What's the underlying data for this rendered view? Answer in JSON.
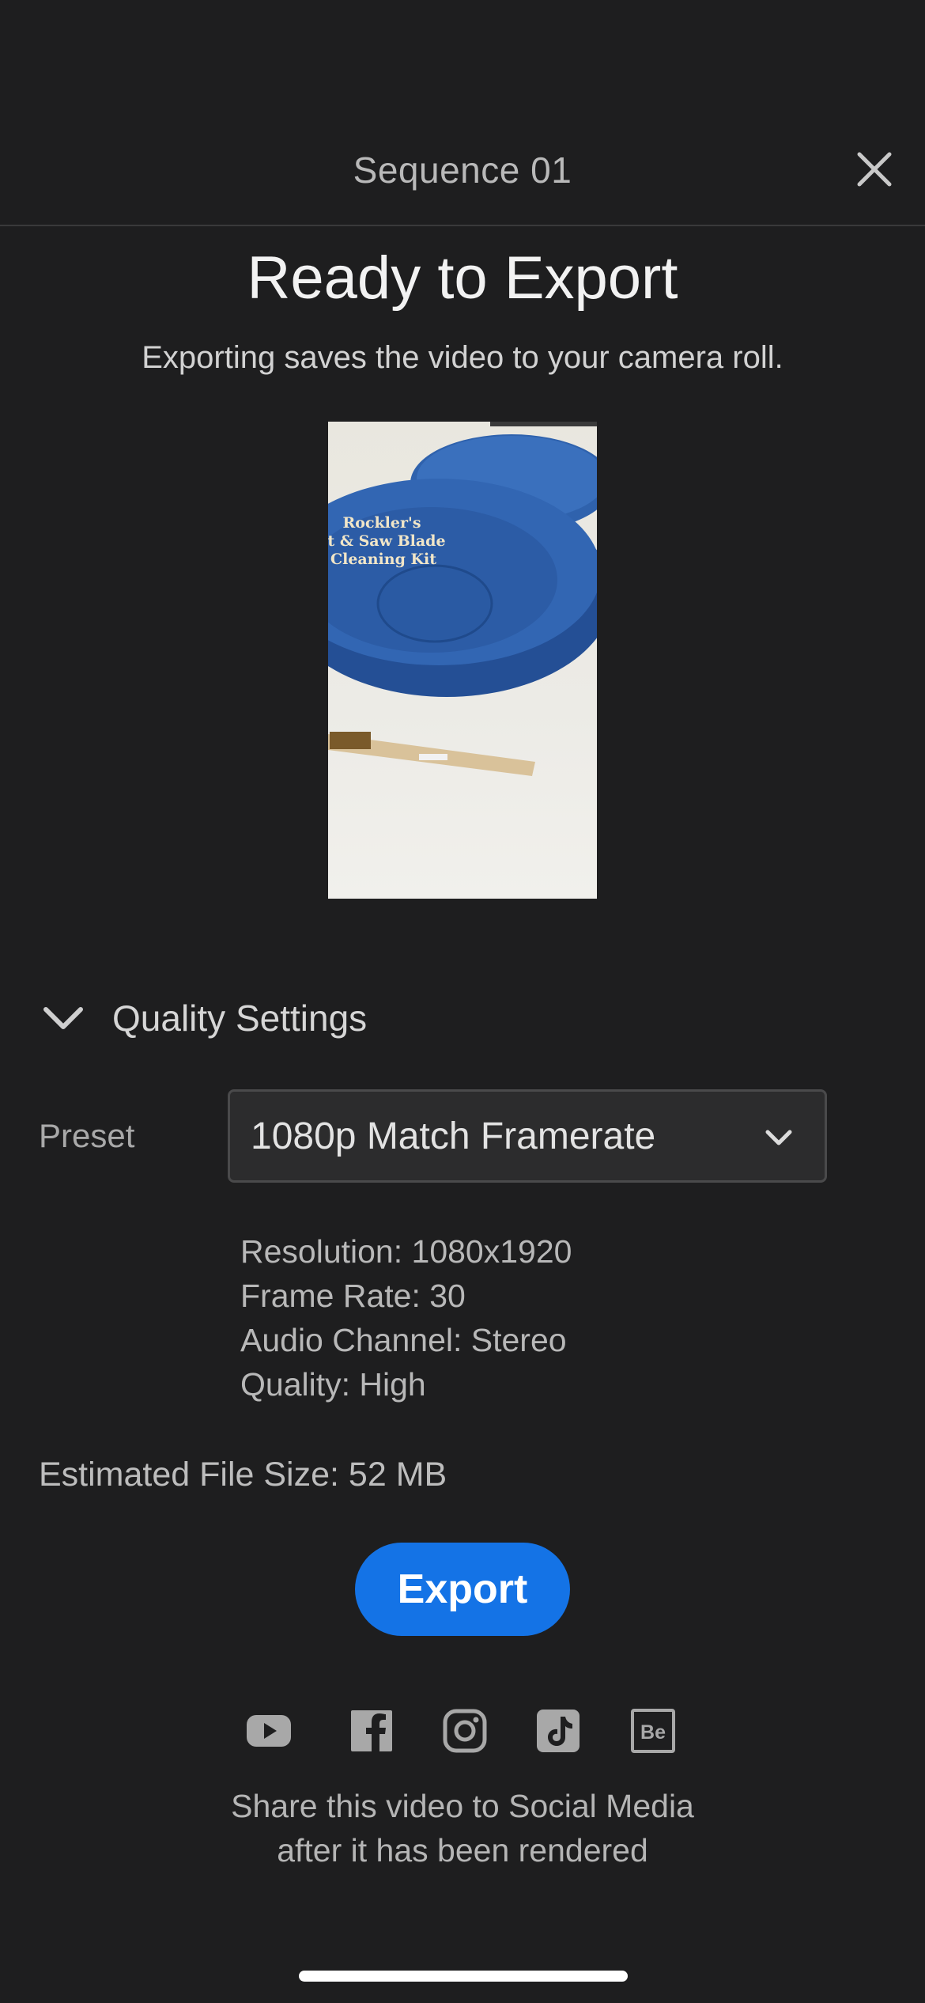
{
  "header": {
    "title": "Sequence 01"
  },
  "main": {
    "title": "Ready to Export",
    "subtitle": "Exporting saves the video to your camera roll."
  },
  "thumbnail": {
    "overlay_lines": [
      "Rockler's",
      "er Bit & Saw Blade",
      "Cleaning Kit"
    ]
  },
  "quality": {
    "section_label": "Quality Settings",
    "preset_label": "Preset",
    "preset_value": "1080p Match Framerate",
    "details": [
      "Resolution: 1080x1920",
      "Frame Rate: 30",
      "Audio Channel: Stereo",
      "Quality: High"
    ],
    "file_size": "Estimated File Size: 52 MB"
  },
  "actions": {
    "export_label": "Export"
  },
  "share": {
    "icons": [
      "youtube-icon",
      "facebook-icon",
      "instagram-icon",
      "tiktok-icon",
      "behance-icon"
    ],
    "line1": "Share this video to Social Media",
    "line2": "after it has been rendered"
  },
  "colors": {
    "background": "#1e1e1f",
    "accent": "#1473e6"
  }
}
